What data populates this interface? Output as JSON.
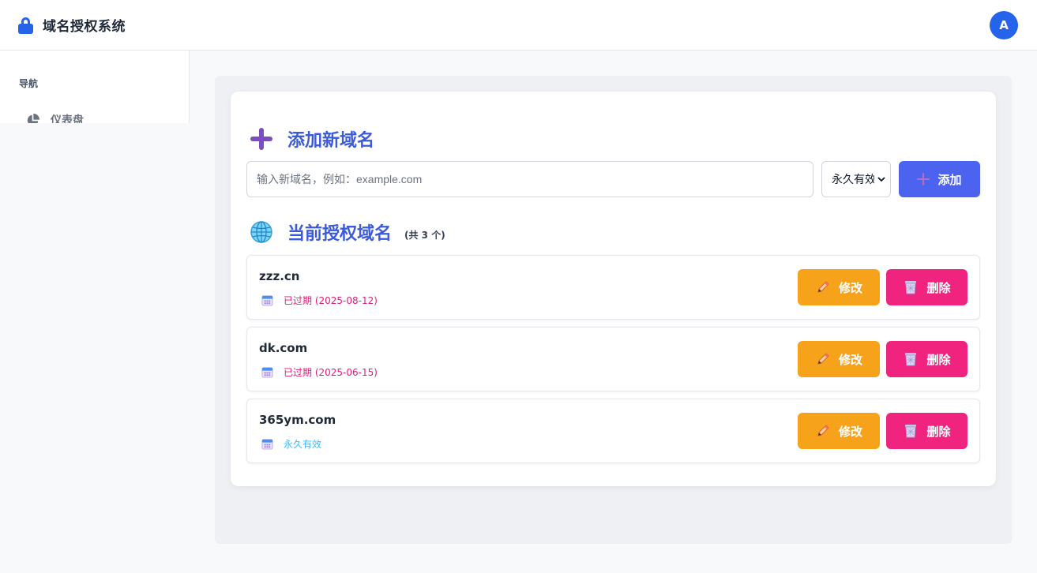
{
  "header": {
    "title": "域名授权系统",
    "avatar_initial": "A",
    "brand_color": "#2563eb"
  },
  "sidebar": {
    "heading": "导航",
    "items": [
      {
        "label": "仪表盘",
        "icon": "pie-chart-icon"
      }
    ]
  },
  "add_section": {
    "title": "添加新域名",
    "input_placeholder": "输入新域名，例如：example.com",
    "input_value": "",
    "duration_selected": "永久有效",
    "add_button_label": "添加"
  },
  "list_section": {
    "title": "当前授权域名",
    "count_text": "(共 3 个)",
    "edit_label": "修改",
    "delete_label": "删除",
    "domains": [
      {
        "name": "zzz.cn",
        "status": "已过期 (2025-08-12)",
        "expired": true
      },
      {
        "name": "dk.com",
        "status": "已过期 (2025-06-15)",
        "expired": true
      },
      {
        "name": "365ym.com",
        "status": "永久有效",
        "expired": false
      }
    ]
  },
  "colors": {
    "accent": "#4c63f0",
    "edit": "#f7a21b",
    "delete": "#f0247f",
    "expired_text": "#e11d74",
    "valid_text": "#38bdf8"
  }
}
